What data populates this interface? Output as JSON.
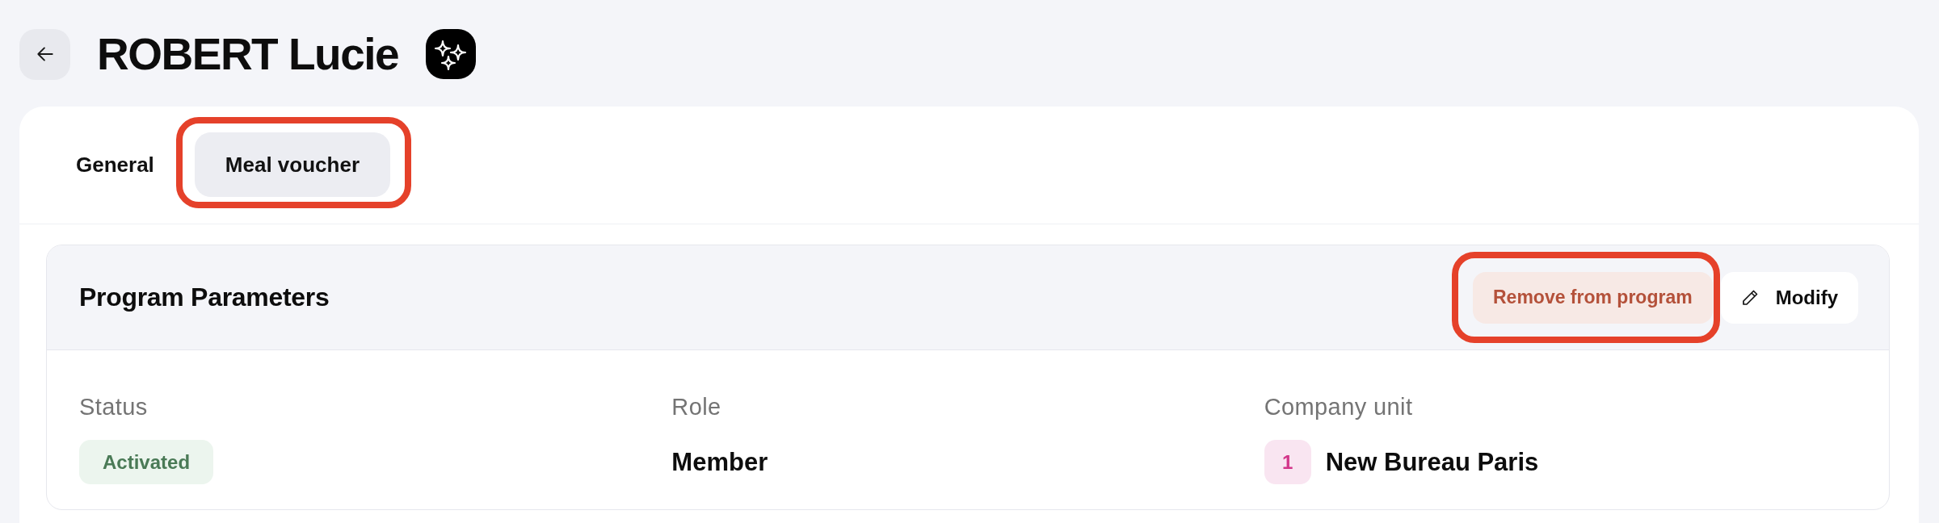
{
  "header": {
    "title": "ROBERT Lucie"
  },
  "tabs": [
    {
      "label": "General",
      "selected": false,
      "highlighted": false
    },
    {
      "label": "Meal voucher",
      "selected": true,
      "highlighted": true
    }
  ],
  "section": {
    "title": "Program Parameters",
    "actions": [
      {
        "label": "Remove from program",
        "kind": "danger",
        "highlighted": true
      },
      {
        "label": "Modify",
        "kind": "edit",
        "highlighted": false
      }
    ],
    "fields": [
      {
        "label": "Status",
        "kind": "badge",
        "value": "Activated"
      },
      {
        "label": "Role",
        "kind": "text",
        "value": "Member"
      },
      {
        "label": "Company unit",
        "kind": "unit",
        "index": "1",
        "value": "New Bureau Paris"
      }
    ]
  }
}
